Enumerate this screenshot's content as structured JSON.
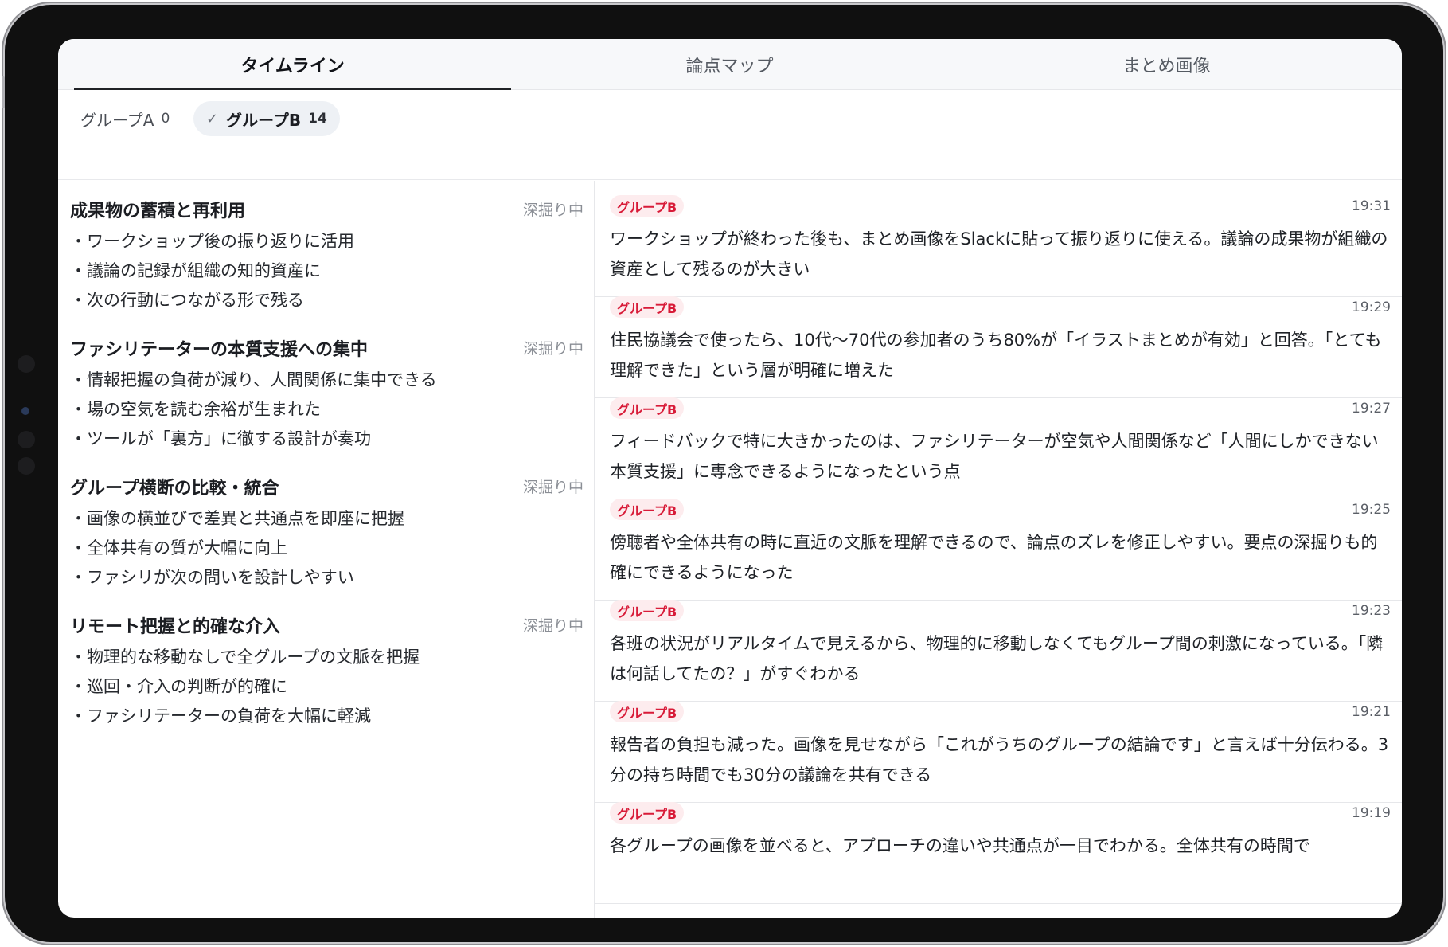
{
  "tabs": [
    {
      "label": "タイムライン",
      "active": true
    },
    {
      "label": "論点マップ",
      "active": false
    },
    {
      "label": "まとめ画像",
      "active": false
    }
  ],
  "filters": {
    "group_a": {
      "label": "グループA",
      "count": "0",
      "selected": false
    },
    "group_b": {
      "label": "グループB",
      "count": "14",
      "selected": true,
      "check_icon": "✓"
    }
  },
  "topics": [
    {
      "title": "成果物の蓄積と再利用",
      "status": "深掘り中",
      "points": [
        "・ワークショップ後の振り返りに活用",
        "・議論の記録が組織の知的資産に",
        "・次の行動につながる形で残る"
      ]
    },
    {
      "title": "ファシリテーターの本質支援への集中",
      "status": "深掘り中",
      "points": [
        "・情報把握の負荷が減り、人間関係に集中できる",
        "・場の空気を読む余裕が生まれた",
        "・ツールが「裏方」に徹する設計が奏功"
      ]
    },
    {
      "title": "グループ横断の比較・統合",
      "status": "深掘り中",
      "points": [
        "・画像の横並びで差異と共通点を即座に把握",
        "・全体共有の質が大幅に向上",
        "・ファシリが次の問いを設計しやすい"
      ]
    },
    {
      "title": "リモート把握と的確な介入",
      "status": "深掘り中",
      "points": [
        "・物理的な移動なしで全グループの文脈を把握",
        "・巡回・介入の判断が的確に",
        "・ファシリテーターの負荷を大幅に軽減"
      ]
    }
  ],
  "timeline": [
    {
      "group": "グループB",
      "time": "19:31",
      "text": "ワークショップが終わった後も、まとめ画像をSlackに貼って振り返りに使える。議論の成果物が組織の資産として残るのが大きい"
    },
    {
      "group": "グループB",
      "time": "19:29",
      "text": "住民協議会で使ったら、10代〜70代の参加者のうち80%が「イラストまとめが有効」と回答。「とても理解できた」という層が明確に増えた"
    },
    {
      "group": "グループB",
      "time": "19:27",
      "text": "フィードバックで特に大きかったのは、ファシリテーターが空気や人間関係など「人間にしかできない本質支援」に専念できるようになったという点"
    },
    {
      "group": "グループB",
      "time": "19:25",
      "text": "傍聴者や全体共有の時に直近の文脈を理解できるので、論点のズレを修正しやすい。要点の深掘りも的確にできるようになった"
    },
    {
      "group": "グループB",
      "time": "19:23",
      "text": "各班の状況がリアルタイムで見えるから、物理的に移動しなくてもグループ間の刺激になっている。「隣は何話してたの？」がすぐわかる"
    },
    {
      "group": "グループB",
      "time": "19:21",
      "text": "報告者の負担も減った。画像を見せながら「これがうちのグループの結論です」と言えば十分伝わる。3分の持ち時間でも30分の議論を共有できる"
    },
    {
      "group": "グループB",
      "time": "19:19",
      "text": "各グループの画像を並べると、アプローチの違いや共通点が一目でわかる。全体共有の時間で"
    }
  ]
}
